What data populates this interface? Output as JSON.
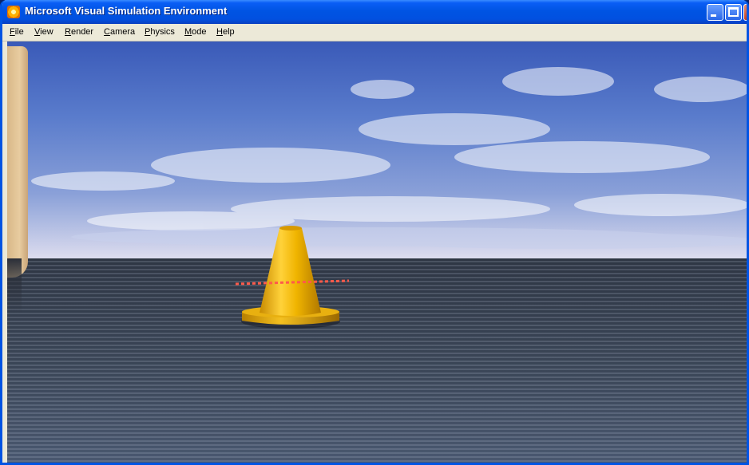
{
  "window": {
    "title": "Microsoft Visual Simulation Environment",
    "icon": "app-sun-icon",
    "controls": [
      "minimize-icon",
      "maximize-icon",
      "close-icon"
    ]
  },
  "menu": {
    "items": [
      {
        "accel": "F",
        "rest": "ile"
      },
      {
        "accel": "V",
        "rest": "iew"
      },
      {
        "accel": "R",
        "rest": "ender"
      },
      {
        "accel": "C",
        "rest": "amera"
      },
      {
        "accel": "P",
        "rest": "hysics"
      },
      {
        "accel": "M",
        "rest": "ode"
      },
      {
        "accel": "H",
        "rest": "elp"
      }
    ]
  },
  "scene": {
    "objects": [
      "sky",
      "ground-plane",
      "traffic-cone",
      "wall-edge"
    ],
    "colors": {
      "sky": "#5a7ccc",
      "ground": "#3a4556",
      "cone": "#f0b400",
      "laser": "#ff5a4a"
    }
  }
}
